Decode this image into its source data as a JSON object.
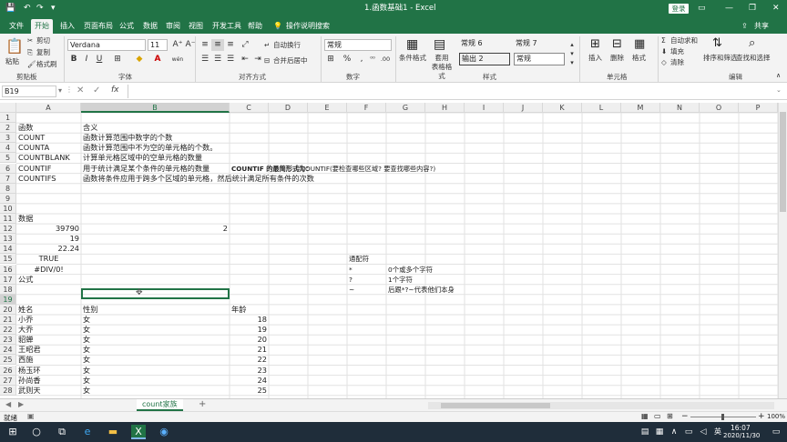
{
  "window": {
    "title": "1.函数基础1 - Excel",
    "login_label": "登录",
    "share_label": "共享",
    "user_initial": "A"
  },
  "tabs": [
    "文件",
    "开始",
    "插入",
    "页面布局",
    "公式",
    "数据",
    "审阅",
    "视图",
    "开发工具",
    "帮助"
  ],
  "active_tab": "开始",
  "tell_me": "操作说明搜索",
  "ribbon": {
    "clipboard": {
      "label": "剪贴板",
      "paste": "粘贴",
      "cut": "剪切",
      "copy": "复制",
      "format_painter": "格式刷"
    },
    "font": {
      "label": "字体",
      "name": "Verdana",
      "size": "11",
      "bold": "B",
      "italic": "I",
      "underline": "U",
      "wen": "wén"
    },
    "alignment": {
      "label": "对齐方式",
      "wrap": "自动换行",
      "merge": "合并后居中"
    },
    "number": {
      "label": "数字",
      "format": "常规",
      "percent": "%",
      "comma": ",",
      "pct_symbol": "⁰⁰",
      "dec": ".00"
    },
    "styles": {
      "label": "样式",
      "cond": "条件格式",
      "table": "套用\n表格格式",
      "normal6": "常规 6",
      "normal7": "常规 7",
      "output2": "输出 2",
      "normal": "常规"
    },
    "cells": {
      "label": "单元格",
      "insert": "插入",
      "delete": "删除",
      "format": "格式"
    },
    "editing": {
      "label": "编辑",
      "autosum": "自动求和",
      "fill": "填充",
      "clear": "清除",
      "sort": "排序和筛选",
      "find": "查找和选择"
    }
  },
  "namebox": "B19",
  "formula_fx": "fx",
  "columns": [
    "A",
    "B",
    "C",
    "D",
    "E",
    "F",
    "G",
    "H",
    "I",
    "J",
    "K",
    "L",
    "M",
    "N",
    "O",
    "P"
  ],
  "rows": [
    "1",
    "2",
    "3",
    "4",
    "5",
    "6",
    "7",
    "8",
    "9",
    "10",
    "11",
    "12",
    "13",
    "14",
    "15",
    "16",
    "17",
    "18",
    "19",
    "20",
    "21",
    "22",
    "23",
    "24",
    "25",
    "26",
    "27",
    "28"
  ],
  "cells": {
    "A2": "函数",
    "B2": "含义",
    "A3": "COUNT",
    "B3": "函数计算范围中数字的个数",
    "A4": "COUNTA",
    "B4": "函数计算范围中不为空的单元格的个数。",
    "A5": "COUNTBLANK",
    "B5": "计算单元格区域中的空单元格的数量",
    "A6": "COUNTIF",
    "B6": "用于统计满足某个条件的单元格的数量",
    "C6": "COUNTIF 的最简形式为：",
    "E6": "=COUNTIF(要检查哪些区域? 要查找哪些内容?)",
    "A7": "COUNTIFS",
    "B7": "函数将条件应用于跨多个区域的单元格，然后统计满足所有条件的次数",
    "A11": "数据",
    "A12": "39790",
    "B12": "2",
    "A13": "19",
    "A14": "22.24",
    "A15": "TRUE",
    "F15": "通配符",
    "A16": "#DIV/0!",
    "F16": "*",
    "G16": "0个或多个字符",
    "A17": "公式",
    "F17": "?",
    "G17": "1个字符",
    "F18": "~",
    "G18": "后跟*?~代表他们本身",
    "A20": "姓名",
    "B20": "性别",
    "C20": "年龄",
    "A21": "小乔",
    "B21": "女",
    "C21": "18",
    "A22": "大乔",
    "B22": "女",
    "C22": "19",
    "A23": "貂蝉",
    "B23": "女",
    "C23": "20",
    "A24": "王昭君",
    "B24": "女",
    "C24": "21",
    "A25": "西施",
    "B25": "女",
    "C25": "22",
    "A26": "杨玉环",
    "B26": "女",
    "C26": "23",
    "A27": "孙尚香",
    "B27": "女",
    "C27": "24",
    "A28": "武则天",
    "B28": "女",
    "C28": "25"
  },
  "sheet_tab": "count家族",
  "add_sheet": "+",
  "status": {
    "ready": "就绪",
    "zoom": "100%",
    "minus": "−",
    "plus": "+"
  },
  "taskbar": {
    "time": "16:07",
    "date": "2020/11/30",
    "lang": "英"
  }
}
